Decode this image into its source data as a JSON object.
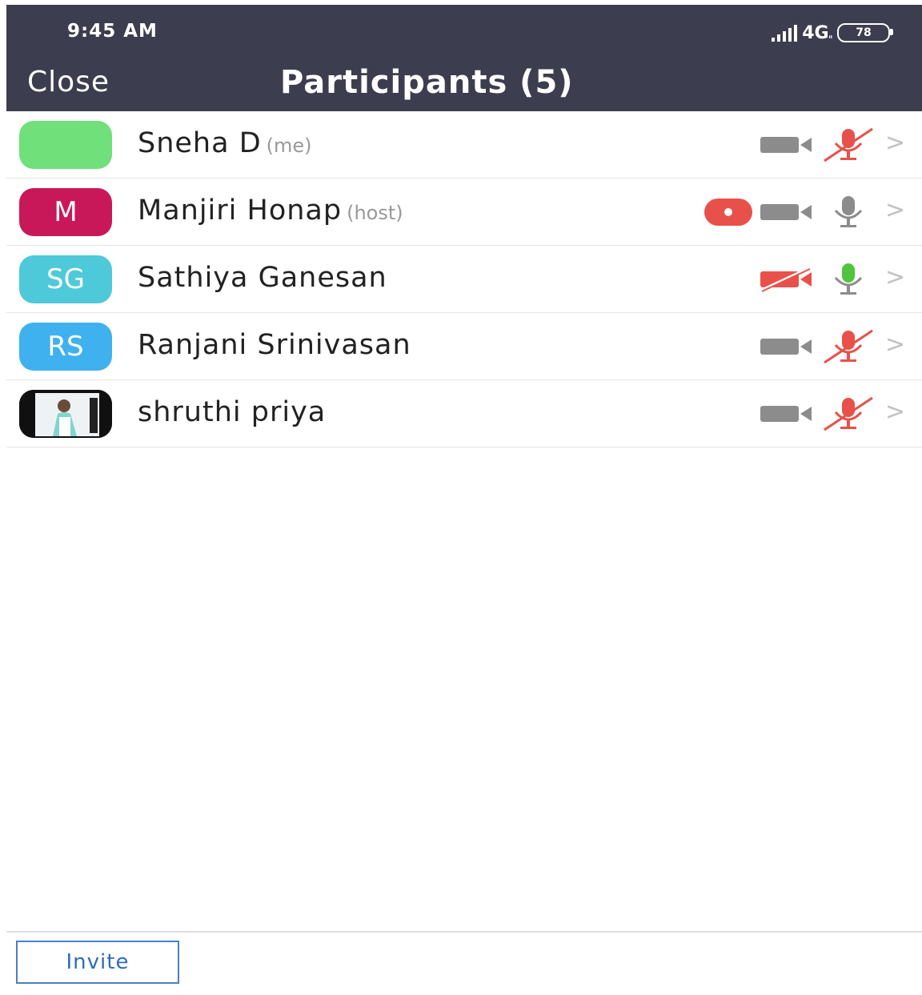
{
  "status_bar": {
    "time": "9:45 AM",
    "network": "4G",
    "network_sub": "ᵢₗ",
    "battery": "78"
  },
  "header": {
    "close_label": "Close",
    "title": "Participants (5)"
  },
  "participants": [
    {
      "name": "Sneha D",
      "tag": "(me)",
      "initials": "",
      "avatar_color": "#6fe07a",
      "recording": false,
      "video": "off",
      "mic": "muted"
    },
    {
      "name": "Manjiri Honap",
      "tag": "(host)",
      "initials": "M",
      "avatar_color": "#c8185a",
      "recording": true,
      "video": "off",
      "mic": "on-idle"
    },
    {
      "name": "Sathiya Ganesan",
      "tag": "",
      "initials": "SG",
      "avatar_color": "#4ec9da",
      "recording": false,
      "video": "blocked",
      "mic": "speaking"
    },
    {
      "name": "Ranjani Srinivasan",
      "tag": "",
      "initials": "RS",
      "avatar_color": "#3fb1ee",
      "recording": false,
      "video": "off",
      "mic": "muted"
    },
    {
      "name": "shruthi priya",
      "tag": "",
      "initials": "",
      "avatar_color": "#101010",
      "recording": false,
      "video": "off",
      "mic": "muted"
    }
  ],
  "footer": {
    "invite_label": "Invite"
  },
  "colors": {
    "header_bg": "#3c3d4e",
    "muted_red": "#e8514a",
    "speaking_green": "#4fc43d",
    "icon_gray": "#8c8c8c",
    "link_blue": "#2f6db8"
  }
}
